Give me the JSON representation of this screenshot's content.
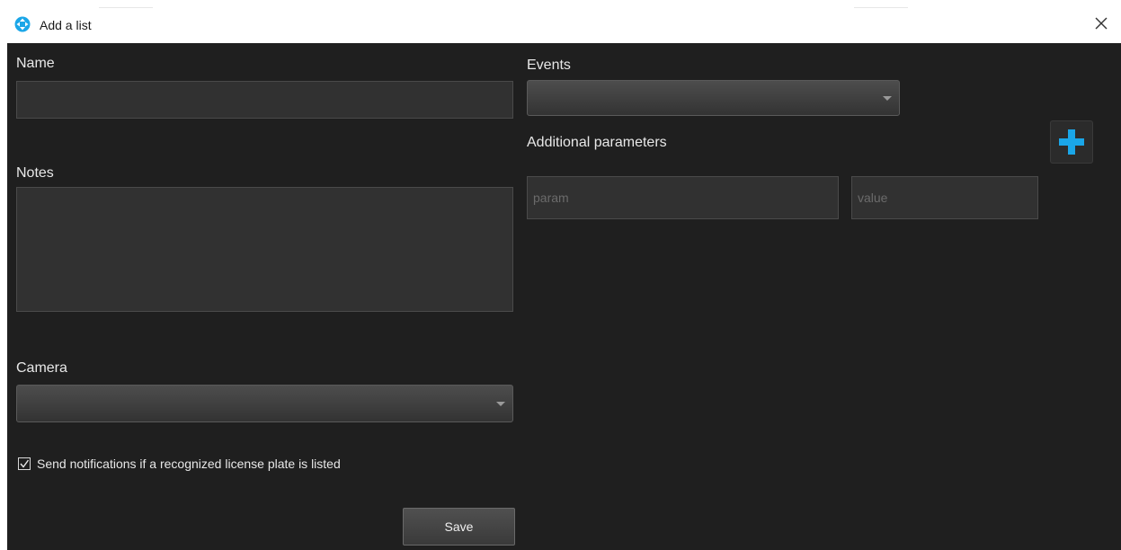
{
  "window": {
    "title": "Add a list",
    "app_icon": "milestone-logo-icon",
    "close_icon": "close-icon"
  },
  "form": {
    "name": {
      "label": "Name",
      "value": ""
    },
    "notes": {
      "label": "Notes",
      "value": ""
    },
    "camera": {
      "label": "Camera",
      "selected": ""
    },
    "notify_checkbox": {
      "label": "Send notifications if a recognized license plate is listed",
      "checked": true
    },
    "save_label": "Save"
  },
  "events": {
    "label": "Events",
    "selected": ""
  },
  "additional_parameters": {
    "label": "Additional parameters",
    "add_icon": "plus-icon",
    "rows": [
      {
        "param_placeholder": "param",
        "value_placeholder": "value"
      }
    ]
  },
  "colors": {
    "background": "#1f1f1f",
    "field": "#313131",
    "accent": "#1aa6e8",
    "text": "#e8e8e8"
  }
}
